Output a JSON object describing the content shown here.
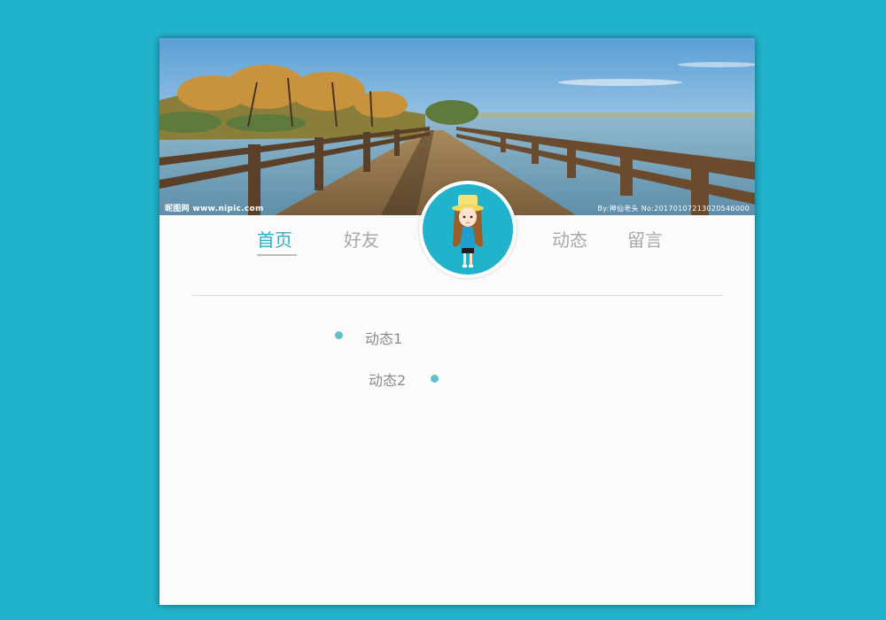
{
  "banner": {
    "watermark_left": "昵图网 www.nipic.com",
    "watermark_right": "By:神仙老头 No:20170107213020546000"
  },
  "nav": {
    "items": [
      {
        "label": "首页",
        "active": true
      },
      {
        "label": "好友",
        "active": false
      },
      {
        "label": "动态",
        "active": false
      },
      {
        "label": "留言",
        "active": false
      }
    ]
  },
  "timeline": {
    "items": [
      {
        "label": "动态1"
      },
      {
        "label": "动态2"
      }
    ]
  },
  "colors": {
    "background": "#22b3cc",
    "accent": "#2ab0c8",
    "dot": "#5fc0c8",
    "inactive_text": "#a8a8a8"
  }
}
